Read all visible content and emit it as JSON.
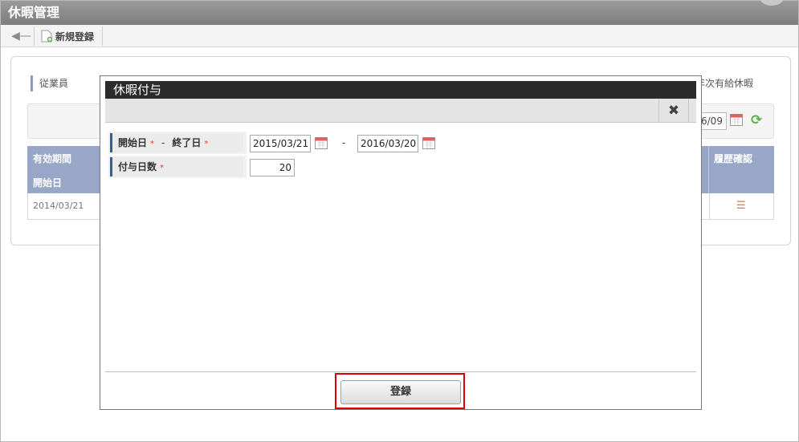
{
  "window": {
    "title": "休暇管理"
  },
  "toolbar": {
    "new_label": "新規登録"
  },
  "background": {
    "employee_label": "従業員",
    "leave_type": "年次有給休暇",
    "date_stub": "6/09",
    "table": {
      "header_period": "有効期間",
      "header_start": "開始日",
      "header_history": "履歴確認",
      "rows": [
        {
          "start_date": "2014/03/21"
        }
      ]
    }
  },
  "dialog": {
    "title": "休暇付与",
    "close_glyph": "✖",
    "fields": {
      "start_label": "開始日",
      "end_label": "終了日",
      "required_mark": "*",
      "range_dash": "-",
      "start_value": "2015/03/21",
      "end_value": "2016/03/20",
      "days_label": "付与日数",
      "days_value": "20"
    },
    "submit_label": "登録"
  },
  "colors": {
    "dialog_header": "#2b2b2b",
    "table_header": "#98a6c8",
    "required": "#e04030",
    "highlight": "#e00000",
    "refresh": "#5ab04a",
    "history_icon": "#e8743a"
  }
}
